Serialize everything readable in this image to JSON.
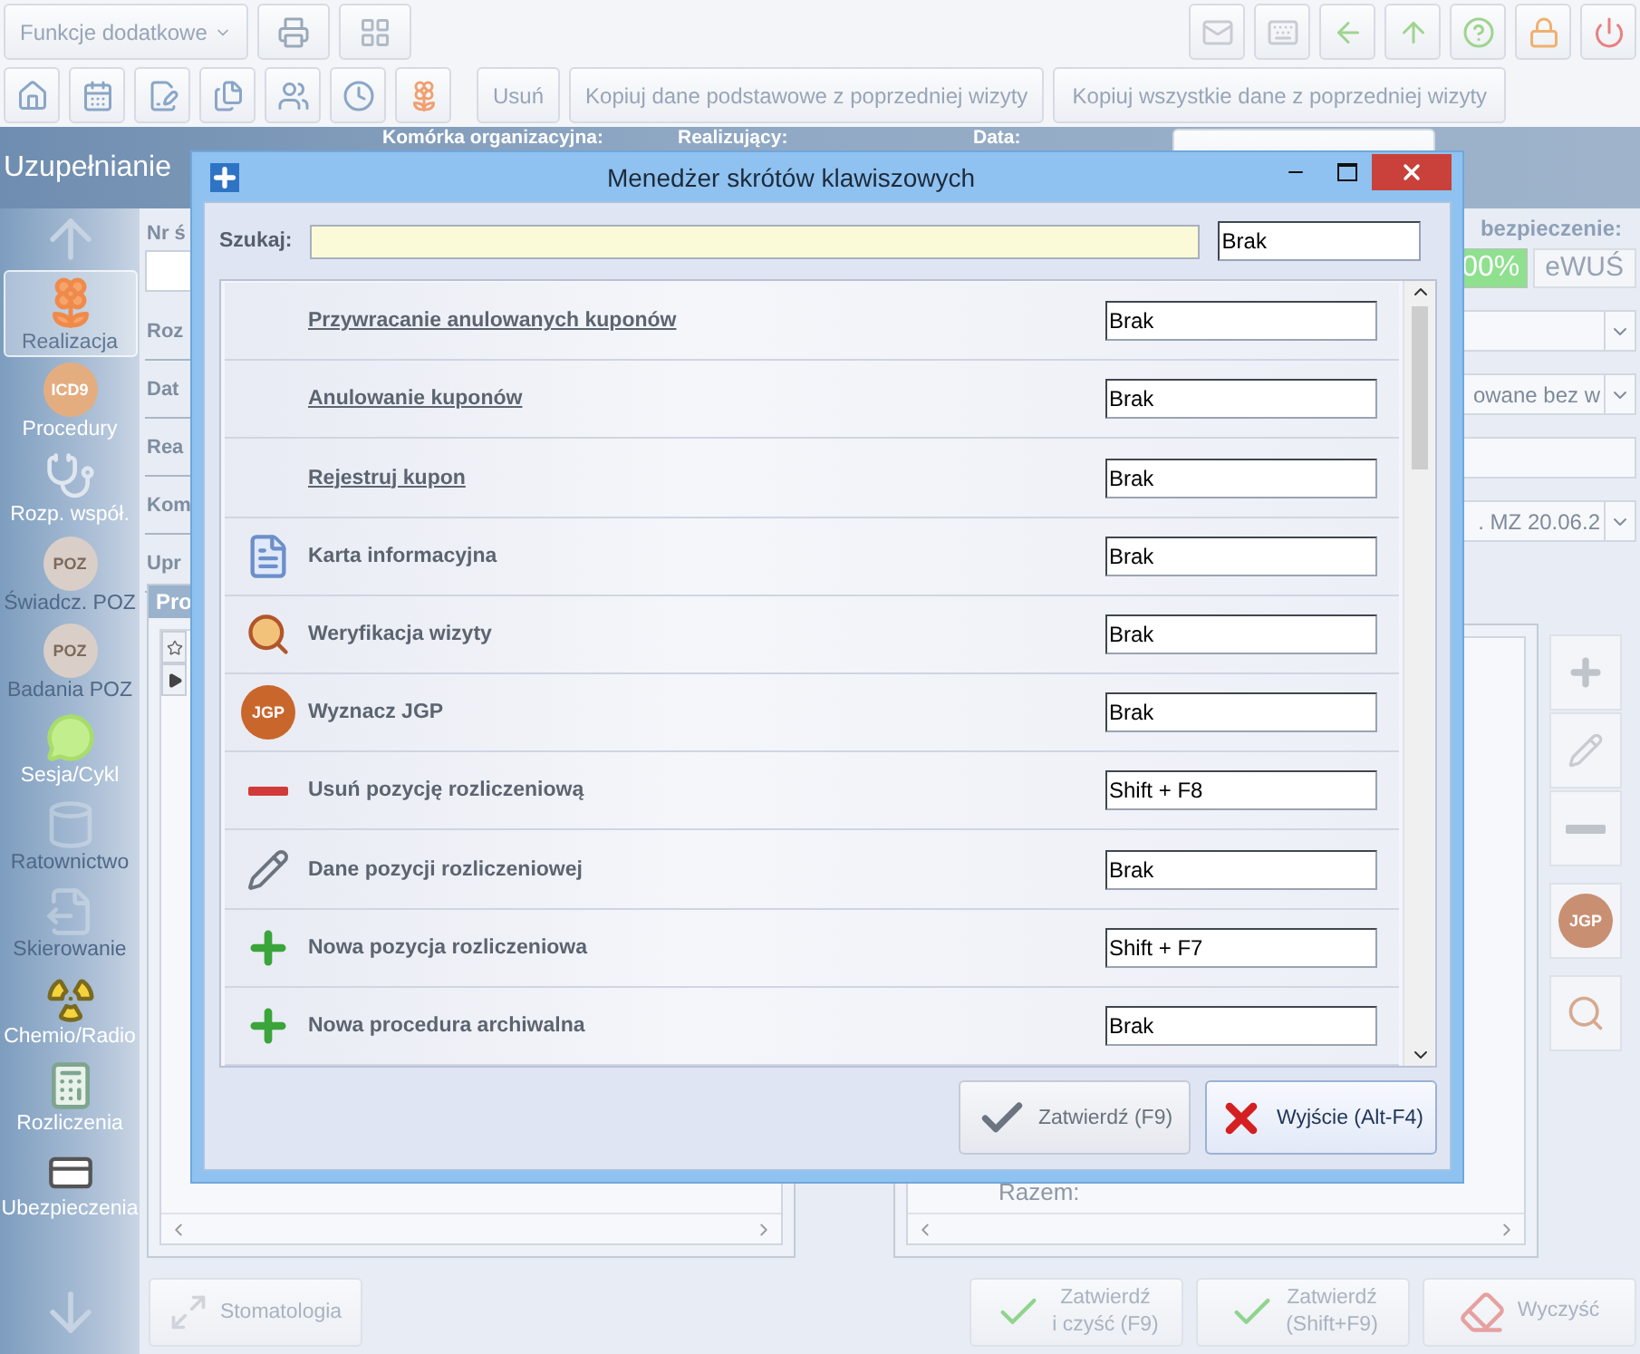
{
  "toolbar": {
    "functions_menu": "Funkcje dodatkowe",
    "actions": [
      "Usuń",
      "Kopiuj dane podstawowe z poprzedniej wizyty",
      "Kopiuj wszystkie dane z poprzedniej wizyty"
    ]
  },
  "header": {
    "title": "Uzupełnianie",
    "fields": [
      "Komórka organizacyjna:",
      "Realizujący:",
      "Data:"
    ]
  },
  "sidebar": {
    "items": [
      {
        "label": "Realizacja",
        "selected": true,
        "disabled": false,
        "kind": "flower"
      },
      {
        "label": "Procedury",
        "selected": false,
        "disabled": false,
        "kind": "badge",
        "badge": "ICD9"
      },
      {
        "label": "Rozp. współ.",
        "selected": false,
        "disabled": false,
        "kind": "stethoscope"
      },
      {
        "label": "Świadcz. POZ",
        "selected": false,
        "disabled": true,
        "kind": "badge",
        "badge": "POZ"
      },
      {
        "label": "Badania POZ",
        "selected": false,
        "disabled": true,
        "kind": "badge",
        "badge": "POZ"
      },
      {
        "label": "Sesja/Cykl",
        "selected": false,
        "disabled": false,
        "kind": "chat"
      },
      {
        "label": "Ratownictwo",
        "selected": false,
        "disabled": true,
        "kind": "cylinder"
      },
      {
        "label": "Skierowanie",
        "selected": false,
        "disabled": true,
        "kind": "referral"
      },
      {
        "label": "Chemio/Radio",
        "selected": false,
        "disabled": false,
        "kind": "hazard"
      },
      {
        "label": "Rozliczenia",
        "selected": false,
        "disabled": false,
        "kind": "calculator"
      },
      {
        "label": "Ubezpieczenia",
        "selected": false,
        "disabled": false,
        "kind": "card"
      }
    ]
  },
  "form": {
    "left_labels": [
      "Nr ś",
      "Roz",
      "Dat",
      "Rea",
      "Kom",
      "Upr"
    ],
    "insurance_label": "bezpieczenie:",
    "insurance_value": "00%",
    "ewus": "eWUŚ",
    "right_fields": [
      {
        "kind": "dropdown"
      },
      {
        "kind": "dropdown",
        "value": "owane bez w"
      },
      {
        "kind": "input"
      },
      {
        "kind": "dropdown",
        "value": ". MZ 20.06.2"
      }
    ]
  },
  "procedures_panel": {
    "title": "Pro"
  },
  "summary_panel": {
    "total_label": "Razem:",
    "side_badge": "JGP"
  },
  "bottom_bar": {
    "left_button": "Stomatologia",
    "buttons": [
      {
        "kind": "confirm_clear",
        "lines": [
          "Zatwierdź",
          "i czyść (F9)"
        ]
      },
      {
        "kind": "confirm",
        "lines": [
          "Zatwierdź",
          "(Shift+F9)"
        ]
      },
      {
        "kind": "clear",
        "lines": [
          "Wyczyść"
        ]
      }
    ]
  },
  "dialog": {
    "title": "Menedżer skrótów klawiszowych",
    "search": {
      "label": "Szukaj:",
      "shortcut": "Brak"
    },
    "rows": [
      {
        "kind": "link",
        "label": "Przywracanie anulowanych kuponów",
        "shortcut": "Brak"
      },
      {
        "kind": "link",
        "label": "Anulowanie kuponów",
        "shortcut": "Brak"
      },
      {
        "kind": "link",
        "label": "Rejestruj kupon",
        "shortcut": "Brak"
      },
      {
        "kind": "document",
        "label": "Karta informacyjna",
        "shortcut": "Brak"
      },
      {
        "kind": "verify",
        "label": "Weryfikacja wizyty",
        "shortcut": "Brak"
      },
      {
        "kind": "badge",
        "badge": "JGP",
        "label": "Wyznacz JGP",
        "shortcut": "Brak"
      },
      {
        "kind": "remove",
        "label": "Usuń pozycję rozliczeniową",
        "shortcut": "Shift + F8"
      },
      {
        "kind": "edit",
        "label": "Dane pozycji rozliczeniowej",
        "shortcut": "Brak"
      },
      {
        "kind": "add",
        "label": "Nowa pozycja rozliczeniowa",
        "shortcut": "Shift + F7"
      },
      {
        "kind": "archive",
        "label": "Nowa procedura archiwalna",
        "shortcut": "Brak"
      }
    ],
    "buttons": [
      {
        "kind": "confirm",
        "label": "Zatwierdź (F9)"
      },
      {
        "kind": "exit",
        "label": "Wyjście (Alt-F4)"
      }
    ]
  }
}
